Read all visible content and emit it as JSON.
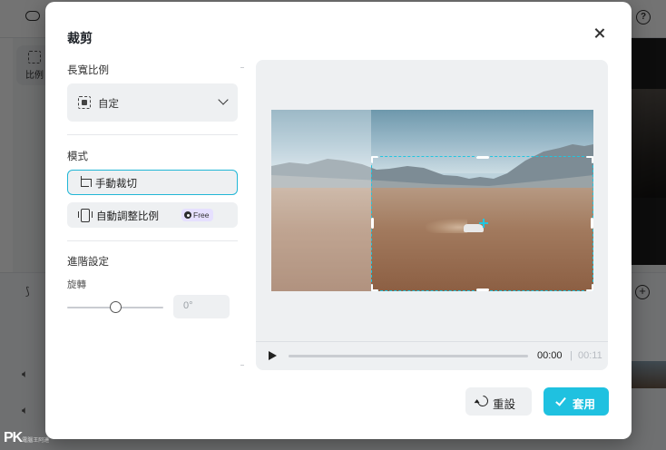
{
  "background": {
    "side_tool_label": "比例"
  },
  "dialog": {
    "title": "裁剪",
    "aspect_ratio": {
      "label": "長寬比例",
      "selected": "自定"
    },
    "mode": {
      "label": "模式",
      "options": [
        {
          "label": "手動裁切",
          "active": true
        },
        {
          "label": "自動調整比例",
          "badge": "Free",
          "active": false
        }
      ]
    },
    "advanced": {
      "label": "進階設定",
      "rotate_label": "旋轉",
      "rotate_value": "0°",
      "rotate_slider_fraction": 0.5
    },
    "player": {
      "current_time": "00:00",
      "separator": "|",
      "total_time": "00:11"
    },
    "buttons": {
      "reset": "重設",
      "apply": "套用"
    }
  },
  "watermark": {
    "main": "PK",
    "sub": "電腦王阿達"
  },
  "colors": {
    "accent": "#1fc1e0",
    "crop_border": "#21c6e0",
    "badge_bg": "#e6e0ff"
  }
}
